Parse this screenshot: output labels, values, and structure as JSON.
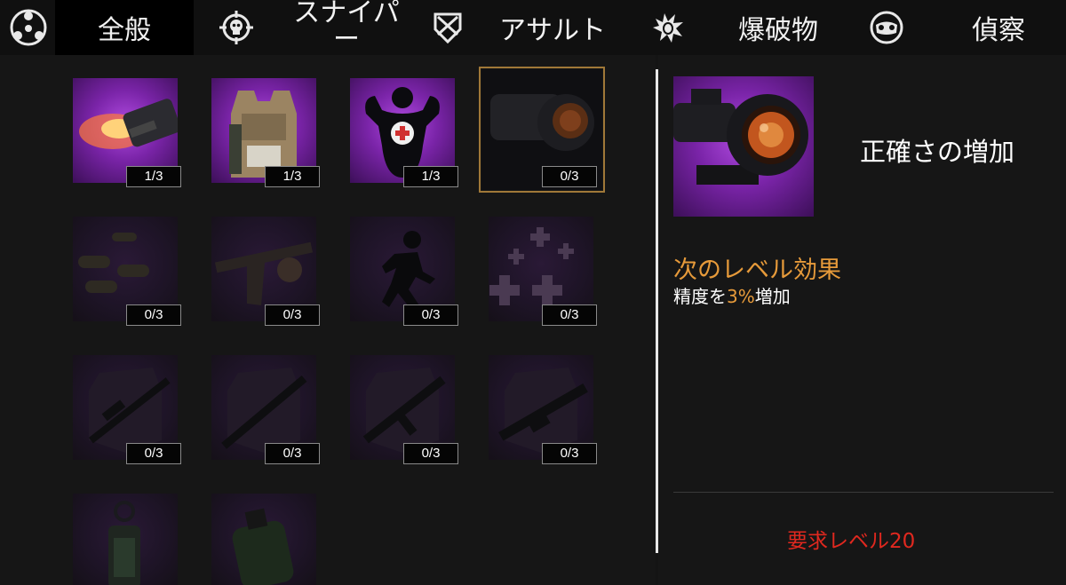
{
  "tabs": [
    {
      "label": "全般",
      "icon": "network-icon"
    },
    {
      "label": "スナイパー",
      "icon": "skull-crosshair-icon"
    },
    {
      "label": "アサルト",
      "icon": "shield-icon"
    },
    {
      "label": "爆破物",
      "icon": "grenade-icon"
    },
    {
      "label": "偵察",
      "icon": "goggles-icon"
    }
  ],
  "perks": [
    {
      "name": "muzzle-flash",
      "count": "1/3",
      "state": "unlocked"
    },
    {
      "name": "body-armor",
      "count": "1/3",
      "state": "unlocked"
    },
    {
      "name": "health-boost",
      "count": "1/3",
      "state": "unlocked"
    },
    {
      "name": "scope",
      "count": "0/3",
      "state": "selected"
    },
    {
      "name": "ammo",
      "count": "0/3",
      "state": "locked"
    },
    {
      "name": "reload",
      "count": "0/3",
      "state": "locked"
    },
    {
      "name": "sprint",
      "count": "0/3",
      "state": "locked"
    },
    {
      "name": "medkit",
      "count": "0/3",
      "state": "locked"
    },
    {
      "name": "sniper-rifle",
      "count": "0/3",
      "state": "locked"
    },
    {
      "name": "shotgun",
      "count": "0/3",
      "state": "locked"
    },
    {
      "name": "assault-rifle",
      "count": "0/3",
      "state": "locked"
    },
    {
      "name": "machine-gun",
      "count": "0/3",
      "state": "locked"
    },
    {
      "name": "stun-grenade",
      "count": "",
      "state": "locked"
    },
    {
      "name": "smoke-grenade",
      "count": "",
      "state": "locked"
    }
  ],
  "detail": {
    "title": "正確さの増加",
    "next_label": "次のレベル効果",
    "effect_pre": "精度を",
    "effect_value": "3%",
    "effect_post": "増加",
    "requirement": "要求レベル20"
  },
  "colors": {
    "accent_orange": "#e69a3a",
    "requirement_red": "#e0281f",
    "selected_border": "#a07838",
    "unlocked_purple": "#7a24a8"
  }
}
